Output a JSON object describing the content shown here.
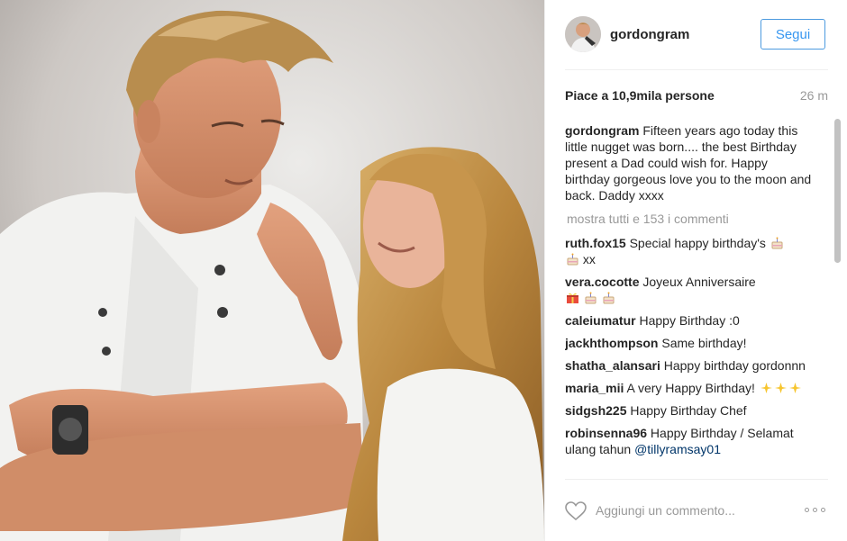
{
  "header": {
    "username": "gordongram",
    "follow_label": "Segui"
  },
  "stats": {
    "likes": "Piace a 10,9mila persone",
    "time": "26 m"
  },
  "caption": {
    "user": "gordongram",
    "text": "Fifteen years ago today this little nugget was born.... the best Birthday present a Dad could wish for. Happy birthday gorgeous love you to the moon and back. Daddy xxxx"
  },
  "show_all": "mostra tutti e 153 i commenti",
  "comments": [
    {
      "user": "ruth.fox15",
      "text": "Special happy birthday's",
      "suffix": "xx"
    },
    {
      "user": "vera.cocotte",
      "text": "Joyeux Anniversaire"
    },
    {
      "user": "caleiumatur",
      "text": "Happy Birthday :0"
    },
    {
      "user": "jackhthompson",
      "text": "Same birthday!"
    },
    {
      "user": "shatha_alansari",
      "text": "Happy birthday gordonnn"
    },
    {
      "user": "maria_mii",
      "text": "A very Happy Birthday!"
    },
    {
      "user": "sidgsh225",
      "text": "Happy Birthday Chef"
    },
    {
      "user": "robinsenna96",
      "text": "Happy Birthday / Selamat ulang tahun",
      "mention": "@tillyramsay01"
    }
  ],
  "footer": {
    "comment_placeholder": "Aggiungi un commento..."
  },
  "icons": {
    "cake": "birthday-cake-icon",
    "gift": "gift-icon",
    "sparkles": "sparkles-icon",
    "heart": "heart-icon",
    "more": "more-options-icon"
  },
  "colors": {
    "follow_blue": "#3897f0",
    "muted": "#999999",
    "text": "#262626"
  }
}
